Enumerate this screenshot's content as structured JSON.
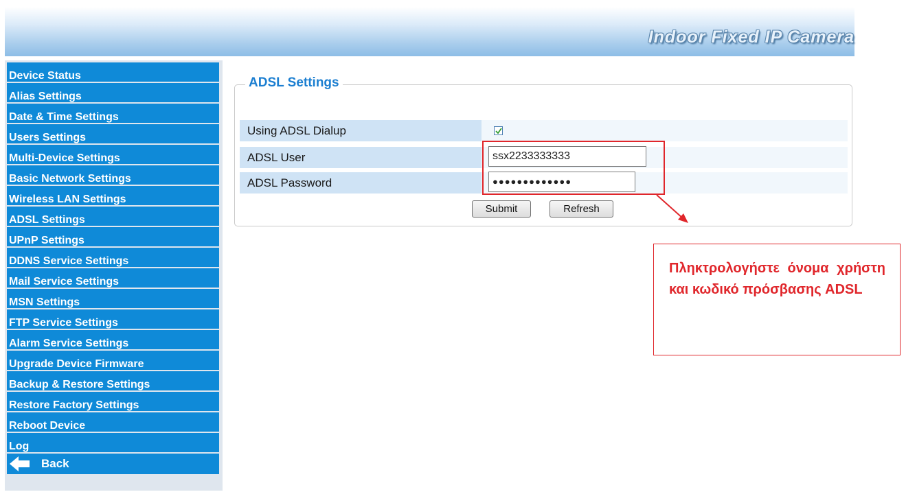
{
  "header": {
    "title": "Indoor Fixed IP Camera"
  },
  "sidebar": {
    "items": [
      {
        "label": "Device Status"
      },
      {
        "label": "Alias Settings"
      },
      {
        "label": "Date & Time Settings"
      },
      {
        "label": "Users Settings"
      },
      {
        "label": "Multi-Device Settings"
      },
      {
        "label": "Basic Network Settings"
      },
      {
        "label": "Wireless LAN Settings"
      },
      {
        "label": "ADSL Settings"
      },
      {
        "label": "UPnP Settings"
      },
      {
        "label": "DDNS Service Settings"
      },
      {
        "label": "Mail Service Settings"
      },
      {
        "label": "MSN Settings"
      },
      {
        "label": "FTP Service Settings"
      },
      {
        "label": "Alarm Service Settings"
      },
      {
        "label": "Upgrade Device Firmware"
      },
      {
        "label": "Backup & Restore Settings"
      },
      {
        "label": "Restore Factory Settings"
      },
      {
        "label": "Reboot Device"
      },
      {
        "label": "Log"
      }
    ],
    "back_label": "Back"
  },
  "panel": {
    "title": "ADSL Settings",
    "dialup_label": "Using ADSL Dialup",
    "dialup_checked": true,
    "user_label": "ADSL User",
    "user_value": "ssx2233333333",
    "password_label": "ADSL Password",
    "password_mask": "●●●●●●●●●●●●●",
    "submit_label": "Submit",
    "refresh_label": "Refresh"
  },
  "annotation": {
    "text": "Πληκτρολογήστε όνομα χρήστη και κωδικό πρόσβασης ADSL",
    "color": "#e0262b"
  },
  "colors": {
    "menu_bg": "#0f8ad8",
    "accent": "#1c7fd1",
    "label_bg": "#cfe3f5"
  }
}
